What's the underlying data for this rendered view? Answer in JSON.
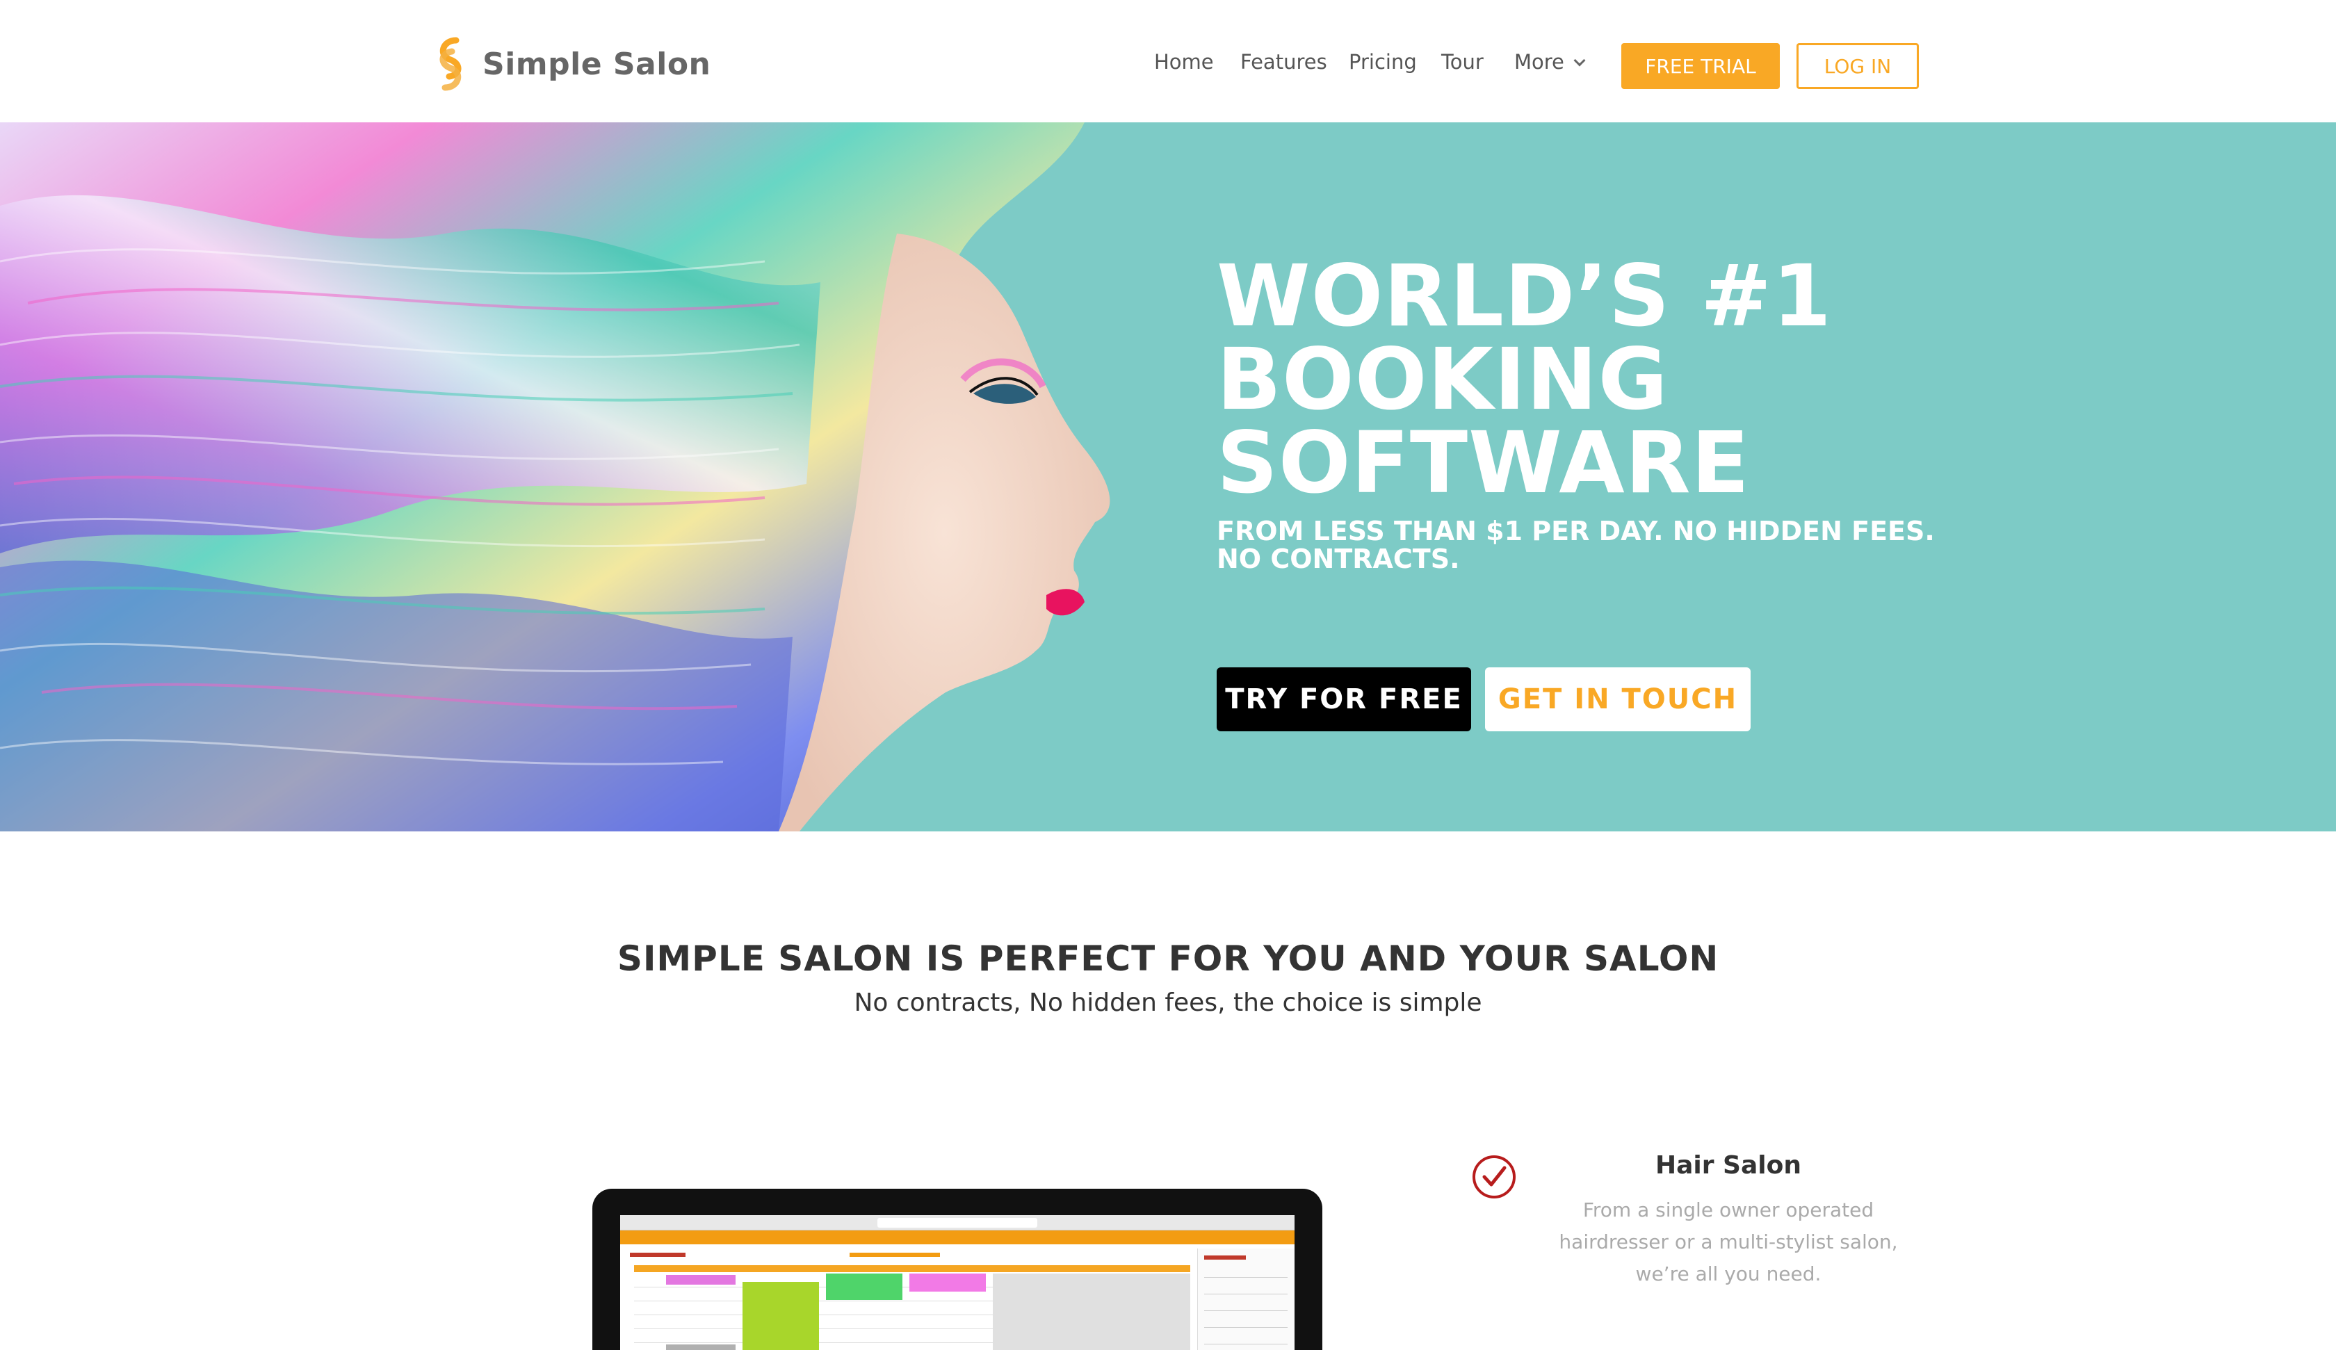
{
  "header": {
    "logo_text": "Simple Salon",
    "nav": [
      {
        "label": "Home"
      },
      {
        "label": "Features"
      },
      {
        "label": "Pricing"
      },
      {
        "label": "Tour"
      },
      {
        "label": "More"
      }
    ],
    "free_trial_label": "FREE TRIAL",
    "login_label": "LOG IN"
  },
  "hero": {
    "title_lines": [
      "WORLD’S #1",
      "BOOKING",
      "SOFTWARE"
    ],
    "subtitle": "FROM LESS THAN $1 PER DAY. NO HIDDEN FEES. NO CONTRACTS.",
    "primary_cta": "TRY FOR FREE",
    "secondary_cta": "GET IN TOUCH"
  },
  "intro": {
    "title": "SIMPLE SALON IS PERFECT FOR YOU AND YOUR SALON",
    "subtitle": "No contracts, No hidden fees, the choice is simple"
  },
  "feature": {
    "icon": "checkmark-circle-icon",
    "title": "Hair Salon",
    "description": "From a single owner operated hairdresser or a multi-stylist salon, we’re all you need."
  },
  "colors": {
    "accent": "#f9a825",
    "hero_bg": "#7dcbc6",
    "check": "#b71c1c"
  }
}
